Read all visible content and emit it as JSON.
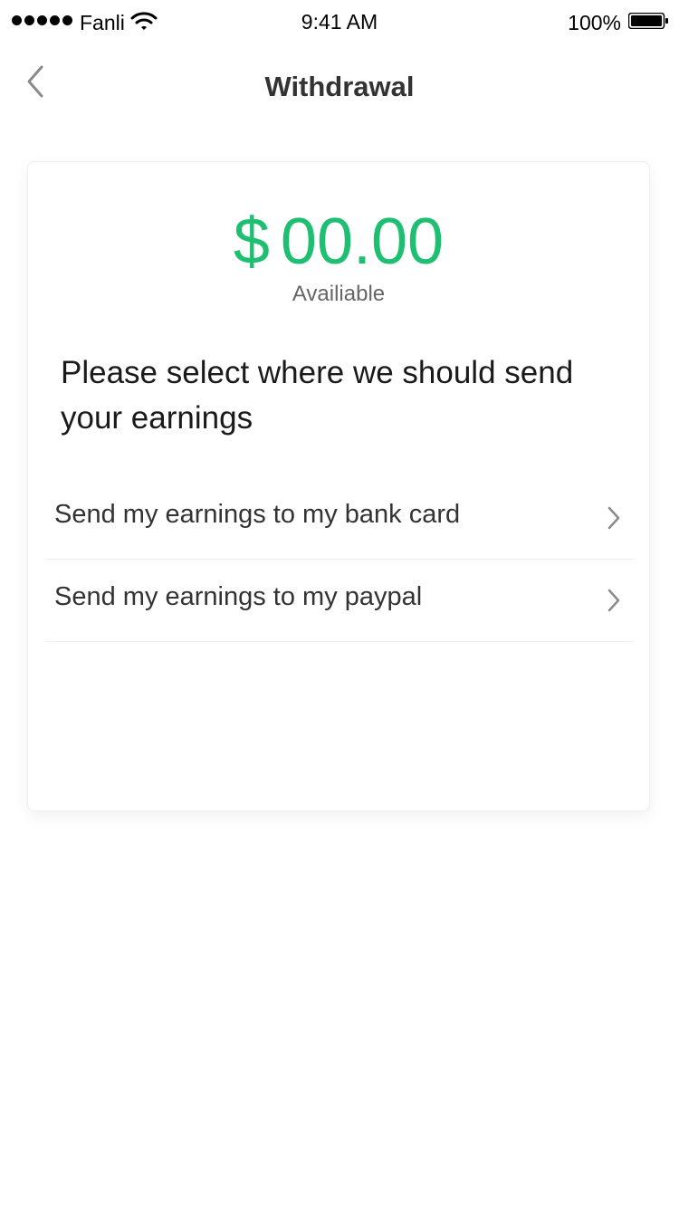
{
  "status_bar": {
    "carrier": "Fanli",
    "time": "9:41 AM",
    "battery_percent": "100%",
    "icons": [
      "signal-dots-icon",
      "wifi-icon",
      "battery-icon"
    ]
  },
  "nav": {
    "title": "Withdrawal",
    "back_icon": "chevron-left-icon"
  },
  "balance": {
    "currency": "$",
    "amount": "00.00",
    "label": "Availiable",
    "color": "#1fbf72"
  },
  "prompt": "Please select where we should send your earnings",
  "options": [
    {
      "label": "Send my earnings to my bank card",
      "icon": "chevron-right-icon"
    },
    {
      "label": "Send my earnings to my paypal",
      "icon": "chevron-right-icon"
    }
  ]
}
